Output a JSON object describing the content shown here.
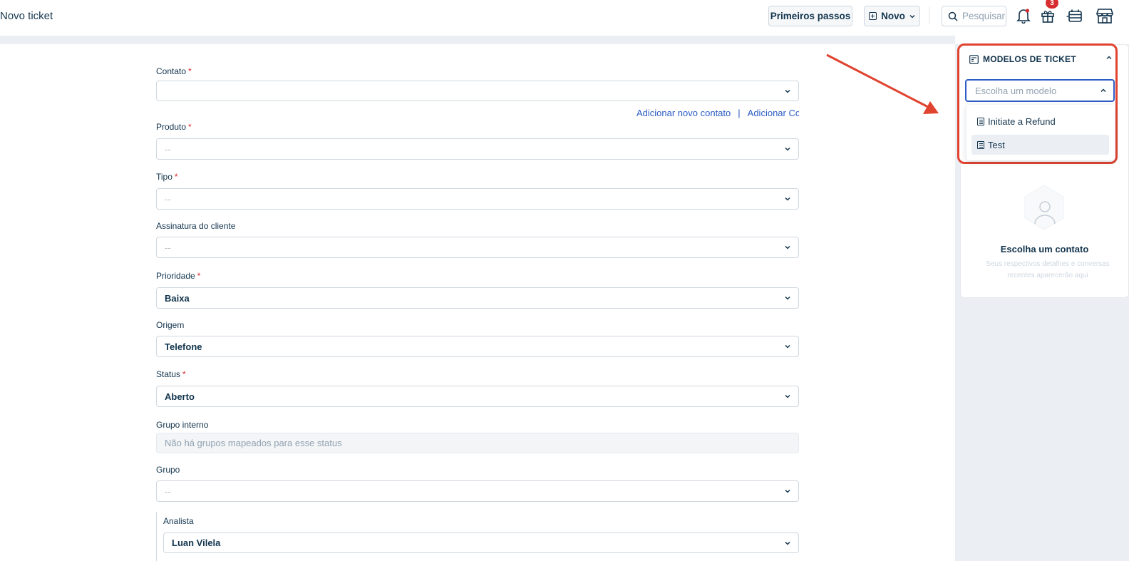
{
  "header": {
    "title": "Novo ticket",
    "primeiros_passos": "Primeiros passos",
    "novo": "Novo",
    "search_placeholder": "Pesquisar",
    "gift_badge": "3"
  },
  "form": {
    "contato": {
      "label": "Contato",
      "value": ""
    },
    "links": {
      "add_contact": "Adicionar novo contato",
      "separator": "|",
      "add_cc": "Adicionar Cc"
    },
    "produto": {
      "label": "Produto",
      "value": "--"
    },
    "tipo": {
      "label": "Tipo",
      "value": "--"
    },
    "assinatura": {
      "label": "Assinatura do cliente",
      "value": "--"
    },
    "prioridade": {
      "label": "Prioridade",
      "value": "Baixa"
    },
    "origem": {
      "label": "Origem",
      "value": "Telefone"
    },
    "status": {
      "label": "Status",
      "value": "Aberto"
    },
    "grupo_interno": {
      "label": "Grupo interno",
      "value": "Não há grupos mapeados para esse status"
    },
    "grupo": {
      "label": "Grupo",
      "value": "--"
    },
    "analista": {
      "label": "Analista",
      "value": "Luan Vilela"
    },
    "required_mark": "*"
  },
  "sidebar": {
    "modelos_title": "MODELOS DE TICKET",
    "model_placeholder": "Escolha um modelo",
    "options": [
      {
        "label": "Initiate a Refund"
      },
      {
        "label": "Test"
      }
    ],
    "contact_title": "Escolha um contato",
    "contact_subtitle": "Seus respectivos detalhes e conversas recentes aparecerão aqui"
  },
  "colors": {
    "accent": "#2c5cc5",
    "highlight_box": "#e0432f",
    "required": "#d72d30",
    "text": "#12344d"
  }
}
